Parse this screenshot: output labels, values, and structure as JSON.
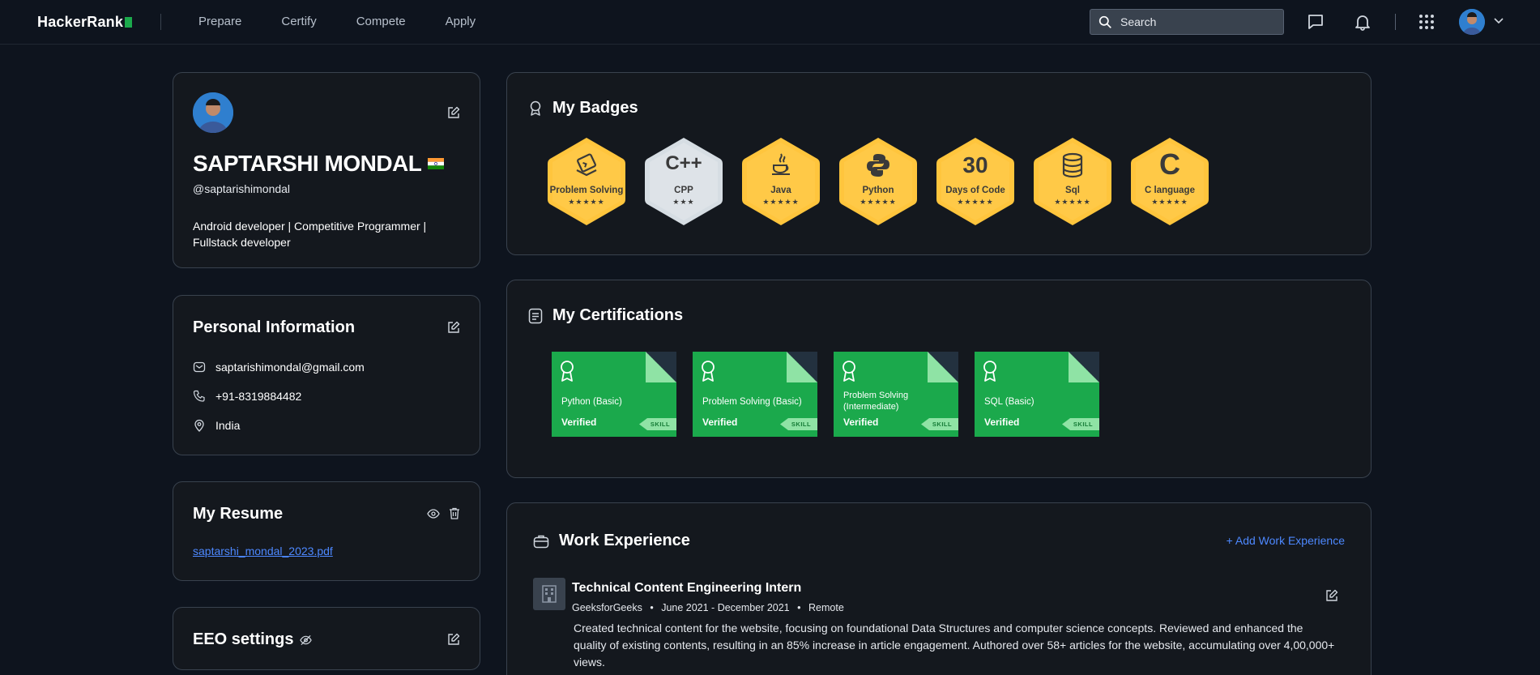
{
  "nav": {
    "logo": "HackerRank",
    "links": [
      "Prepare",
      "Certify",
      "Compete",
      "Apply"
    ],
    "search_placeholder": "Search"
  },
  "profile": {
    "name": "SAPTARSHI MONDAL",
    "handle": "@saptarishimondal",
    "bio": "Android developer | Competitive Programmer | Fullstack developer"
  },
  "personal_info": {
    "title": "Personal Information",
    "email": "saptarishimondal@gmail.com",
    "phone": "+91-8319884482",
    "location": "India"
  },
  "resume": {
    "title": "My Resume",
    "file": "saptarshi_mondal_2023.pdf"
  },
  "eeo": {
    "title": "EEO settings"
  },
  "badges": {
    "title": "My Badges",
    "items": [
      {
        "label": "Problem Solving",
        "icon": "terminal-icon",
        "stars": "★★★★★",
        "color": "gold"
      },
      {
        "label": "CPP",
        "icon": "C++",
        "stars": "★★★",
        "color": "silver"
      },
      {
        "label": "Java",
        "icon": "java-icon",
        "stars": "★★★★★",
        "color": "gold"
      },
      {
        "label": "Python",
        "icon": "python-icon",
        "stars": "★★★★★",
        "color": "gold"
      },
      {
        "label": "Days of Code",
        "icon": "30",
        "stars": "★★★★★",
        "color": "gold"
      },
      {
        "label": "Sql",
        "icon": "database-icon",
        "stars": "★★★★★",
        "color": "gold"
      },
      {
        "label": "C language",
        "icon": "C",
        "stars": "★★★★★",
        "color": "gold"
      }
    ]
  },
  "certifications": {
    "title": "My Certifications",
    "items": [
      {
        "name": "Python (Basic)",
        "status": "Verified",
        "tag": "SKILL"
      },
      {
        "name": "Problem Solving (Basic)",
        "status": "Verified",
        "tag": "SKILL"
      },
      {
        "name": "Problem Solving (Intermediate)",
        "status": "Verified",
        "tag": "SKILL"
      },
      {
        "name": "SQL (Basic)",
        "status": "Verified",
        "tag": "SKILL"
      }
    ]
  },
  "work": {
    "title": "Work Experience",
    "add_label": "+ Add Work Experience",
    "job_title": "Technical Content Engineering Intern",
    "company": "GeeksforGeeks",
    "dates": "June 2021 - December 2021",
    "mode": "Remote",
    "description": "Created technical content for the website, focusing on foundational Data Structures and computer science concepts. Reviewed and enhanced the quality of existing contents, resulting in an 85% increase in article engagement. Authored over 58+ articles for the website, accumulating over 4,00,000+ views."
  },
  "colors": {
    "background": "#0e141e",
    "card": "#14181e",
    "border": "#39424e",
    "accent_green": "#1ba94c",
    "link_blue": "#4d88ff",
    "badge_gold": "#ffc53d",
    "badge_silver": "#d6dde3"
  }
}
